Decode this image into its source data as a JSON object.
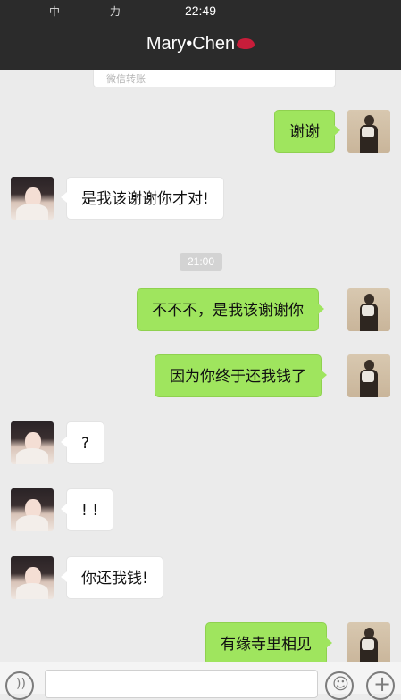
{
  "status_bar": {
    "carrier": "中 力",
    "time": "22:49"
  },
  "header": {
    "contact_name": "Mary•Chen",
    "icon": "lips-emoji-icon"
  },
  "transfer_card": {
    "label": "微信转账"
  },
  "timestamp": "21:00",
  "messages": [
    {
      "sender": "me",
      "text": "谢谢"
    },
    {
      "sender": "her",
      "text": "是我该谢谢你才对!"
    },
    {
      "sender": "me",
      "text": "不不不，是我该谢谢你"
    },
    {
      "sender": "me",
      "text": "因为你终于还我钱了"
    },
    {
      "sender": "her",
      "text": "?"
    },
    {
      "sender": "her",
      "text": "! !"
    },
    {
      "sender": "her",
      "text": "你还我钱!"
    },
    {
      "sender": "me",
      "text": "有缘寺里相见"
    }
  ],
  "input_bar": {
    "voice_icon": "voice-icon",
    "emoji_icon": "emoji-icon",
    "plus_icon": "plus-icon"
  }
}
